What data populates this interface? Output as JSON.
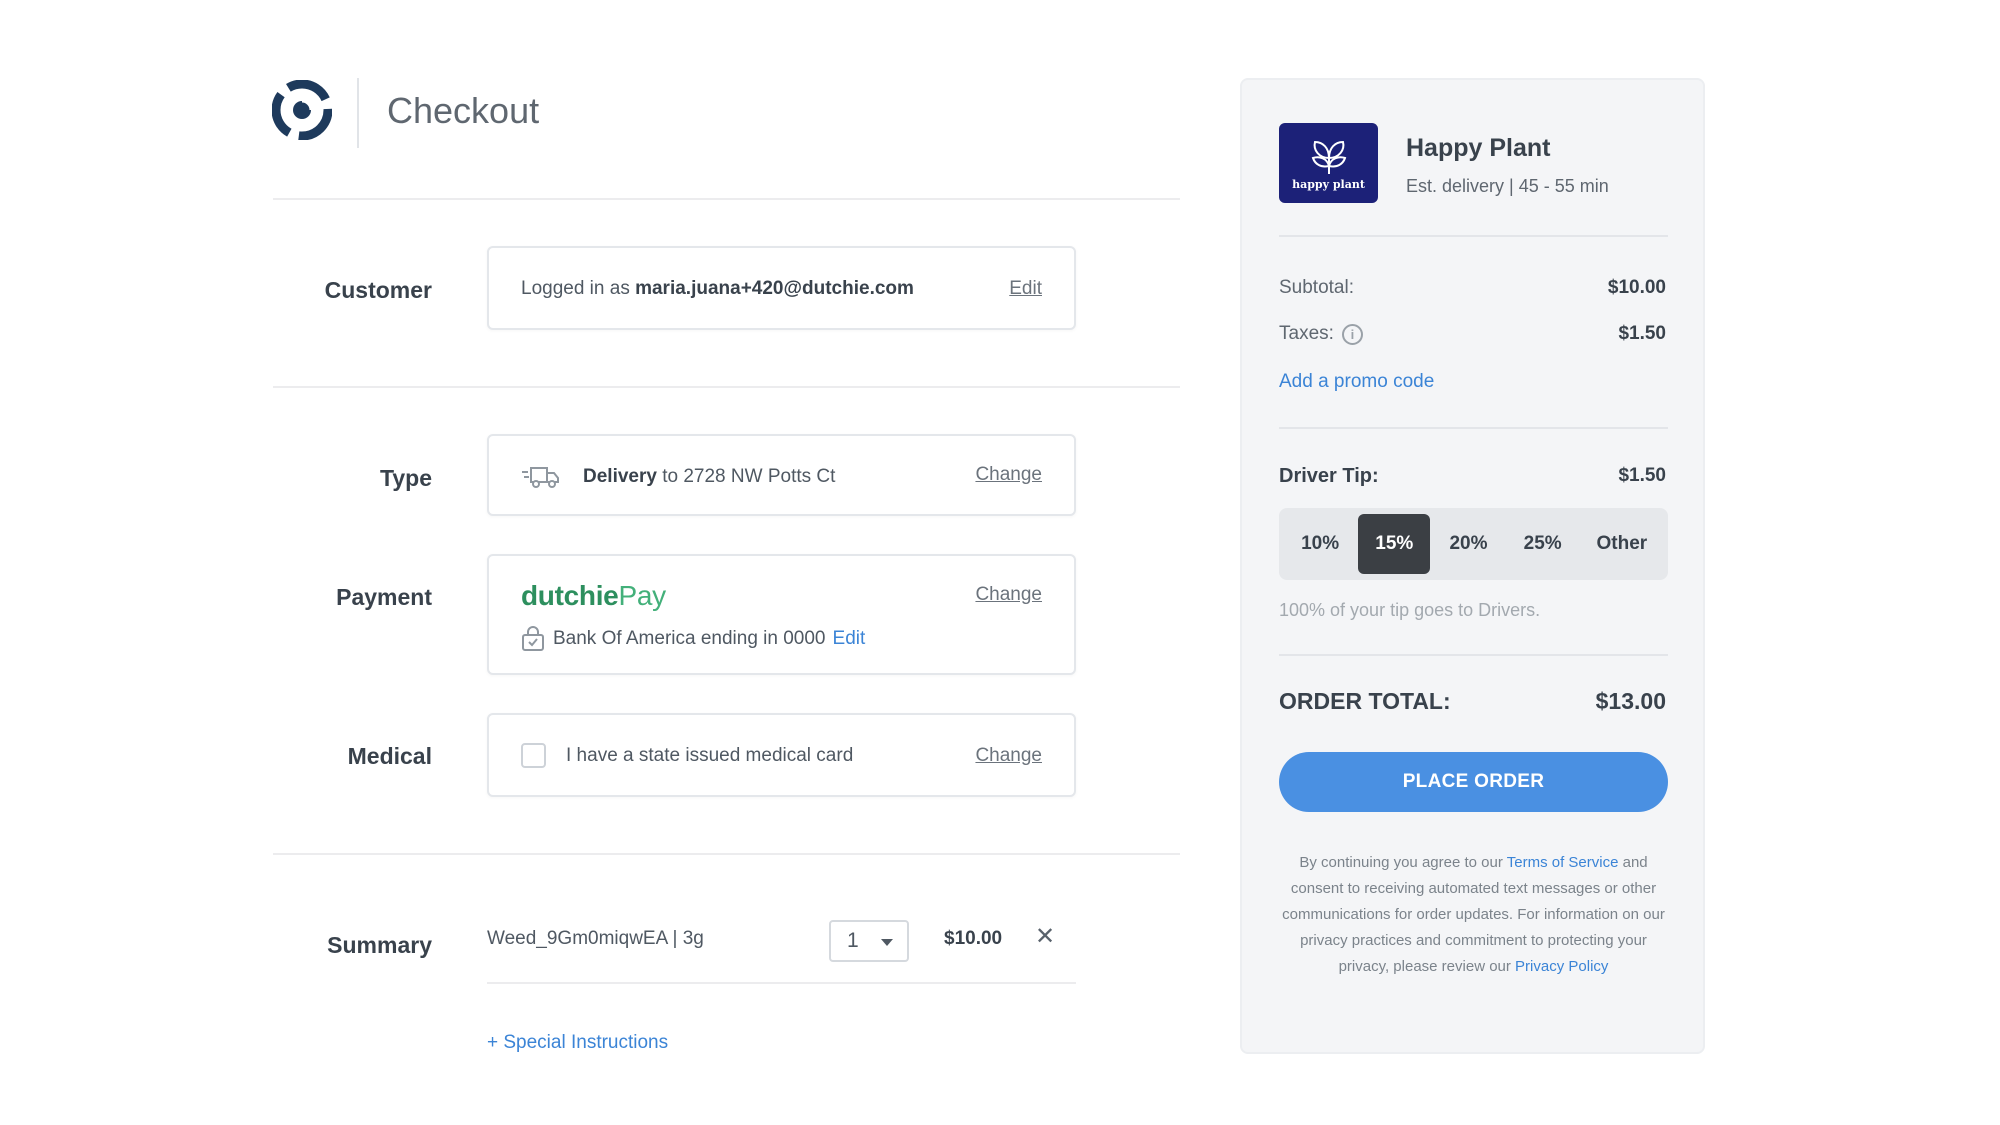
{
  "header": {
    "title": "Checkout"
  },
  "customer": {
    "label": "Customer",
    "prefix": "Logged in as ",
    "email": "maria.juana+420@dutchie.com",
    "edit": "Edit"
  },
  "type": {
    "label": "Type",
    "mode": "Delivery",
    "address": " to 2728 NW Potts Ct",
    "change": "Change"
  },
  "payment": {
    "label": "Payment",
    "brand_main": "dutchie",
    "brand_suffix": "Pay",
    "bank": "Bank Of America ending in 0000",
    "edit": "Edit",
    "change": "Change"
  },
  "medical": {
    "label": "Medical",
    "checkbox_label": "I have a state issued medical card",
    "change": "Change"
  },
  "summary": {
    "label": "Summary",
    "item_name": "Weed_9Gm0miqwEA | 3g",
    "quantity": "1",
    "price": "$10.00",
    "remove": "✕",
    "special": "+ Special Instructions"
  },
  "store": {
    "logo_text": "happy plant",
    "name": "Happy Plant",
    "eta": "Est. delivery | 45 - 55 min"
  },
  "totals": {
    "subtotal_label": "Subtotal:",
    "subtotal": "$10.00",
    "taxes_label": "Taxes:",
    "taxes": "$1.50",
    "promo": "Add a promo code",
    "tip_label": "Driver Tip:",
    "tip": "$1.50",
    "tip_options": [
      "10%",
      "15%",
      "20%",
      "25%",
      "Other"
    ],
    "tip_selected": "15%",
    "tip_note": "100% of your tip goes to Drivers.",
    "order_total_label": "ORDER TOTAL:",
    "order_total": "$13.00",
    "place_order": "PLACE ORDER"
  },
  "legal": {
    "part1": "By continuing you agree to our ",
    "terms": "Terms of Service",
    "part2": " and consent to receiving automated text messages or other communications for order updates. For information on our privacy practices and commitment to protecting your privacy, please review our ",
    "privacy": "Privacy Policy"
  },
  "colors": {
    "link_blue": "#3b84d6",
    "button_blue": "#4a90e2",
    "dutchie_green": "#2d8f5e",
    "tip_selected_bg": "#3b3f44",
    "store_logo_bg": "#1c2178"
  }
}
